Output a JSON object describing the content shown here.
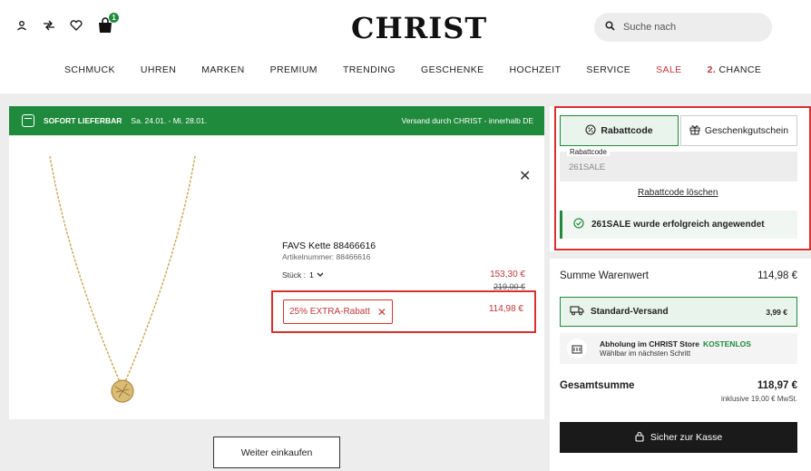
{
  "header": {
    "logo": "CHRIST",
    "cart_count": "1",
    "search_placeholder": "Suche nach",
    "icons": [
      "account-icon",
      "compare-icon",
      "wishlist-icon",
      "cart-icon",
      "search-icon"
    ]
  },
  "nav": {
    "items": [
      "SCHMUCK",
      "UHREN",
      "MARKEN",
      "PREMIUM",
      "TRENDING",
      "GESCHENKE",
      "HOCHZEIT",
      "SERVICE",
      "SALE"
    ],
    "chance_prefix": "2.",
    "chance_label": "CHANCE"
  },
  "availability": {
    "label": "SOFORT LIEFERBAR",
    "dates": "Sa. 24.01. - Mi. 28.01.",
    "shipping_note": "Versand durch CHRIST - innerhalb DE"
  },
  "product": {
    "name": "FAVS Kette 88466616",
    "article_label": "Artikelnummer:",
    "article_number": "88466616",
    "qty_label": "Stück :",
    "qty_value": "1",
    "price_now": "153,30 €",
    "price_old": "219,00 €",
    "discount_label": "25% EXTRA-Rabatt",
    "discount_price": "114,98 €"
  },
  "continue_label": "Weiter einkaufen",
  "voucher": {
    "tab_code": "Rabattcode",
    "tab_gift": "Geschenkgutschein",
    "field_label": "Rabattcode",
    "field_value": "261SALE",
    "delete_label": "Rabattcode löschen",
    "success_message": "261SALE wurde erfolgreich angewendet"
  },
  "summary": {
    "subtotal_label": "Summe Warenwert",
    "subtotal_value": "114,98 €",
    "shipping_label": "Standard-Versand",
    "shipping_price": "3,99 €",
    "store_title": "Abholung im CHRIST Store",
    "store_free": "KOSTENLOS",
    "store_note": "Wählbar im nächsten Schritt",
    "total_label": "Gesamtsumme",
    "total_value": "118,97 €",
    "tax_note": "inklusive 19,00 € MwSt.",
    "checkout_label": "Sicher zur Kasse"
  },
  "colors": {
    "brand_green": "#1f8a3c",
    "sale_red": "#c0373b",
    "highlight_red": "#d9302f"
  }
}
